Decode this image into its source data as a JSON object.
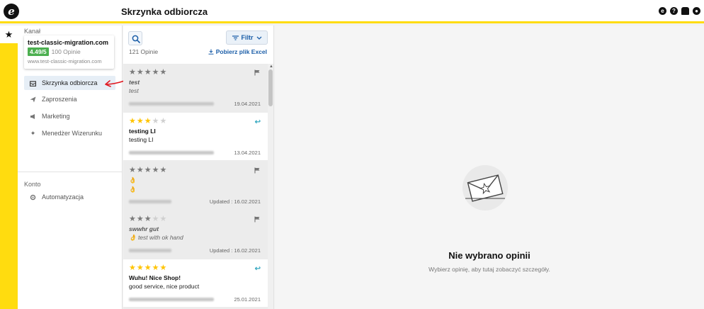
{
  "app": {
    "logo_letter": "e",
    "page_title": "Skrzynka odbiorcza"
  },
  "top_icons": [
    "trusted-icon",
    "help-icon",
    "bell-icon",
    "user-icon"
  ],
  "rail": {
    "star": "★"
  },
  "sidebar": {
    "channel_label": "Kanał",
    "channel": {
      "name": "test-classic-migration.com",
      "rating": "4.49/5",
      "opinions": "100 Opinie",
      "url": "www.test-classic-migration.com"
    },
    "items": [
      {
        "label": "Skrzynka odbiorcza",
        "icon": "inbox-icon",
        "active": true
      },
      {
        "label": "Zaproszenia",
        "icon": "send-icon"
      },
      {
        "label": "Marketing",
        "icon": "megaphone-icon"
      },
      {
        "label": "Menedżer Wizerunku",
        "icon": "sparkle-icon"
      }
    ],
    "account_label": "Konto",
    "account_items": [
      {
        "label": "Automatyzacja",
        "icon": "automation-icon"
      }
    ]
  },
  "list": {
    "filter_label": "Filtr",
    "count": "121 Opinie",
    "download_label": "Pobierz plik Excel",
    "reviews": [
      {
        "rating": 5,
        "read": true,
        "title": "test",
        "body": "test",
        "date": "19.04.2021",
        "status": "flag",
        "italic": true
      },
      {
        "rating": 3,
        "read": false,
        "title": "testing LI",
        "body": "testing LI",
        "date": "13.04.2021",
        "status": "reply",
        "italic": false
      },
      {
        "rating": 5,
        "read": true,
        "title": "👌",
        "body": "👌",
        "date": "Updated : 16.02.2021",
        "status": "flag",
        "italic": false
      },
      {
        "rating": 3,
        "read": true,
        "title": "swwhr gut",
        "body": "👌 test with ok hand",
        "date": "Updated : 16.02.2021",
        "status": "flag",
        "italic": true
      },
      {
        "rating": 5,
        "read": false,
        "title": "Wuhu! Nice Shop!",
        "body": "good service, nice product",
        "date": "25.01.2021",
        "status": "reply",
        "italic": false
      }
    ]
  },
  "detail": {
    "empty_title": "Nie wybrano opinii",
    "empty_subtitle": "Wybierz opinię, aby tutaj zobaczyć szczegóły."
  },
  "colors": {
    "accent": "#ffdc0f",
    "link": "#1b5ea8",
    "rating_badge": "#4caf50",
    "star": "#ffc400",
    "reply": "#35a8c0"
  }
}
